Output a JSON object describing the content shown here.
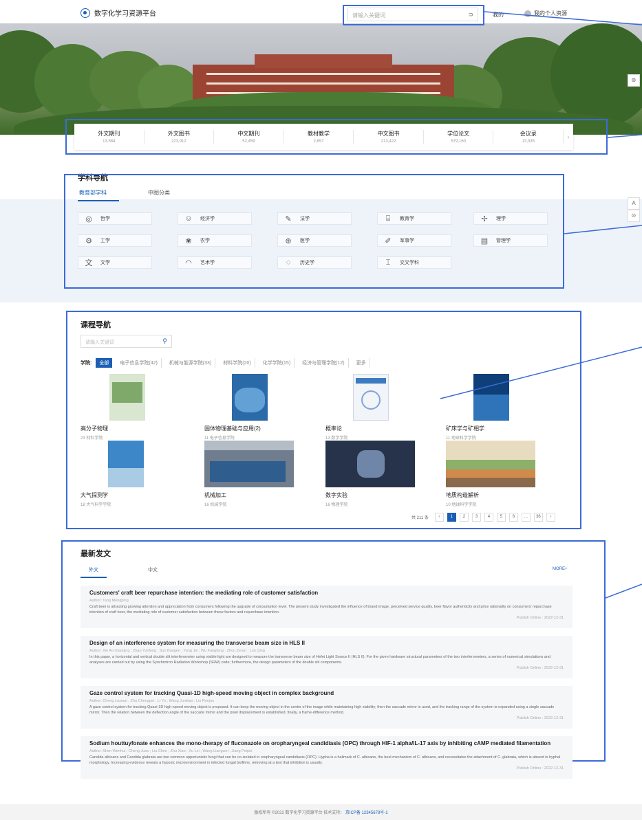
{
  "header": {
    "site_name": "数字化学习资源平台",
    "search_placeholder": "请输入关键词",
    "search_go": "⊃",
    "nav_home": "我的",
    "nav_user": "我的个人资源"
  },
  "stats": [
    {
      "label": "外文期刊",
      "value": "13,584"
    },
    {
      "label": "外文图书",
      "value": "223,912"
    },
    {
      "label": "中文期刊",
      "value": "52,459"
    },
    {
      "label": "教材教学",
      "value": "2,657"
    },
    {
      "label": "中文图书",
      "value": "213,422"
    },
    {
      "label": "学位论文",
      "value": "579,160"
    },
    {
      "label": "会议录",
      "value": "13,335"
    }
  ],
  "subject_nav": {
    "title": "学科导航",
    "tabs": [
      "教育部学科",
      "中图分类"
    ],
    "active_tab": 0,
    "items": [
      {
        "label": "哲学",
        "icon": "philosophy-icon",
        "glyph": "◎"
      },
      {
        "label": "经济学",
        "icon": "economics-icon",
        "glyph": "☺"
      },
      {
        "label": "法学",
        "icon": "law-icon",
        "glyph": "✎"
      },
      {
        "label": "教育学",
        "icon": "education-icon",
        "glyph": "⌸"
      },
      {
        "label": "理学",
        "icon": "science-icon",
        "glyph": "✢"
      },
      {
        "label": "工学",
        "icon": "engineering-icon",
        "glyph": "⚙"
      },
      {
        "label": "农学",
        "icon": "agriculture-icon",
        "glyph": "❀"
      },
      {
        "label": "医学",
        "icon": "medicine-icon",
        "glyph": "⊕"
      },
      {
        "label": "军事学",
        "icon": "military-icon",
        "glyph": "✐"
      },
      {
        "label": "管理学",
        "icon": "management-icon",
        "glyph": "▤"
      },
      {
        "label": "文学",
        "icon": "literature-icon",
        "glyph": "文"
      },
      {
        "label": "艺术学",
        "icon": "art-icon",
        "glyph": "◠"
      },
      {
        "label": "历史学",
        "icon": "history-icon",
        "glyph": "◌"
      },
      {
        "label": "交叉学科",
        "icon": "interdisciplinary-icon",
        "glyph": "⌶"
      }
    ]
  },
  "side_widgets": [
    "⊛",
    "A",
    "⊙"
  ],
  "course_nav": {
    "title": "课程导航",
    "search_placeholder": "请输入关键词",
    "filter_label": "学院:",
    "filters": [
      "全部",
      "电子信息学院(42)",
      "机械与能源学院(33)",
      "材料学院(20)",
      "化学学院(15)",
      "经济与管理学院(12)",
      "更多"
    ],
    "active_filter": 0,
    "cards": [
      {
        "title": "高分子物理",
        "sub": "23 材料学院",
        "img": "book-green"
      },
      {
        "title": "固体物理基础与应用(2)",
        "sub": "11 电子信息学院",
        "img": "book-blue"
      },
      {
        "title": "概率论",
        "sub": "13 数学学院",
        "img": "book-white"
      },
      {
        "title": "矿床学与矿相学",
        "sub": "11 地球科学学院",
        "img": "book-ocean"
      },
      {
        "title": "大气探测学",
        "sub": "18 大气科学学院",
        "img": "book-sky"
      },
      {
        "title": "机械加工",
        "sub": "16 机械学院",
        "img": "photo-factory"
      },
      {
        "title": "数字实验",
        "sub": "16 物理学院",
        "img": "photo-lab"
      },
      {
        "title": "地质构造解析",
        "sub": "10 地球科学学院",
        "img": "photo-geology"
      }
    ],
    "pager": {
      "total": "共 211 条",
      "prev": "‹",
      "pages": [
        "1",
        "2",
        "3",
        "4",
        "5",
        "6",
        "...",
        "36"
      ],
      "current": "1",
      "next": "›"
    }
  },
  "latest": {
    "title": "最新发文",
    "tabs": [
      "外文",
      "中文"
    ],
    "active_tab": 0,
    "more": "MORE+",
    "articles": [
      {
        "title": "Customers' craft beer repurchase intention: the mediating role of customer satisfaction",
        "author": "Author: Tang Mengping",
        "abstract": "Craft beer is attracting growing attention and appreciation from consumers following the upgrade of consumption level. The present study investigated the influence of brand image, perceived service quality, beer flavor authenticity and price rationality on consumers' repurchase intention of craft beer, the mediating role of customer satisfaction between these factors and repurchase intention.",
        "date": "Publish Online : 2022-12-31"
      },
      {
        "title": "Design of an interference system for measuring the transverse beam size in HLS II",
        "author": "Author: Xie Ao-Xiaoqing ; Zhao Yunfeng ; Sun Baogen ; Yang Jie ; Wu Fangfang ; Zhou Zeran ; Luo Qing",
        "abstract": "In this paper, a horizontal and vertical double slit interferometer using visible light are designed to measure the transverse beam size of Hefei Light Source II (HLS II). For the given hardware structural parameters of the two interferometers, a series of numerical simulations and analyses are carried out by using the Synchrotron Radiation Workshop (SRW) code; furthermore, the design parameters of the double slit components.",
        "date": "Publish Online : 2022-12-31"
      },
      {
        "title": "Gaze control system for tracking Quasi-1D high-speed moving object in complex background",
        "author": "Author: Cheng Luxuan ; Zhu Chengpei ; Li Yu ; Wang Junbiao ; Liu Renjun",
        "abstract": "A gaze control system for tracking Quasi-1D high-speed moving object is proposed. It can keep the moving object in the center of the image while maintaining high stability; then the saccade mirror is used, and the tracking range of the system is expanded using a single saccade mirror. Then the relation between the deflection angle of the saccade mirror and the pixel displacement is established, finally, a frame-difference method.",
        "date": "Publish Online : 2022-12-31"
      },
      {
        "title": "Sodium houttuyfonate enhances the mono-therapy of fluconazole on oropharyngeal candidiasis (OPC) through HIF-1 alpha/IL-17 axis by inhibiting cAMP mediated filamentation",
        "author": "Author: Shen Wenhui ; Cheng Juan ; Liu Chen ; Zhu Xiao ; Xu Lei ; Wang Liangwei ; Jiang Peipei",
        "abstract": "Candida albicans and Candida glabrata are two common opportunistic fungi that can be co-isolated in oropharyngeal candidiasis (OPC). Hypha is a hallmark of C. albicans, the best mechanism of C. albicans, and necessitates the attachment of C. glabrata, which is absent in hyphal morphology. Increasing evidence reveals a hypoxic microenvironment in infected fungal biofilms, removing at a test that inhibition is usually.",
        "date": "Publish Online : 2022-12-31"
      }
    ]
  },
  "footer": {
    "text": "版权所有 ©2022 数字化学习资源平台 技术支持：",
    "link": "京ICP备 12345678号-1"
  },
  "colors": {
    "accent": "#1a5fb4",
    "highlight": "#3b6bd6"
  }
}
